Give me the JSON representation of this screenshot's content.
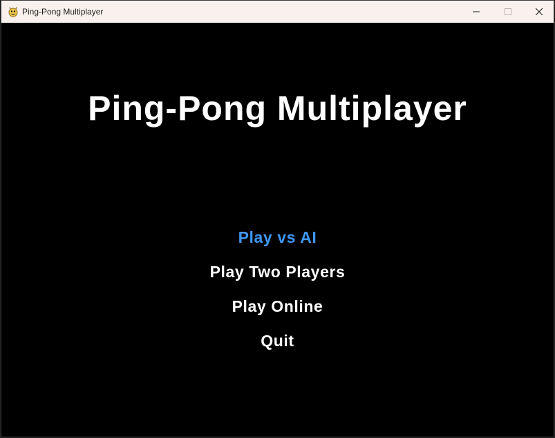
{
  "window": {
    "title": "Ping-Pong Multiplayer",
    "app_icon": "pygame-snake-icon",
    "controls": [
      "minimize-icon",
      "maximize-icon",
      "close-icon"
    ]
  },
  "game": {
    "title": "Ping-Pong Multiplayer",
    "background_color": "#000000",
    "text_color": "#ffffff",
    "highlight_color": "#3f97f5",
    "menu": [
      {
        "label": "Play vs AI",
        "selected": true
      },
      {
        "label": "Play Two Players",
        "selected": false
      },
      {
        "label": "Play Online",
        "selected": false
      },
      {
        "label": "Quit",
        "selected": false
      }
    ]
  }
}
